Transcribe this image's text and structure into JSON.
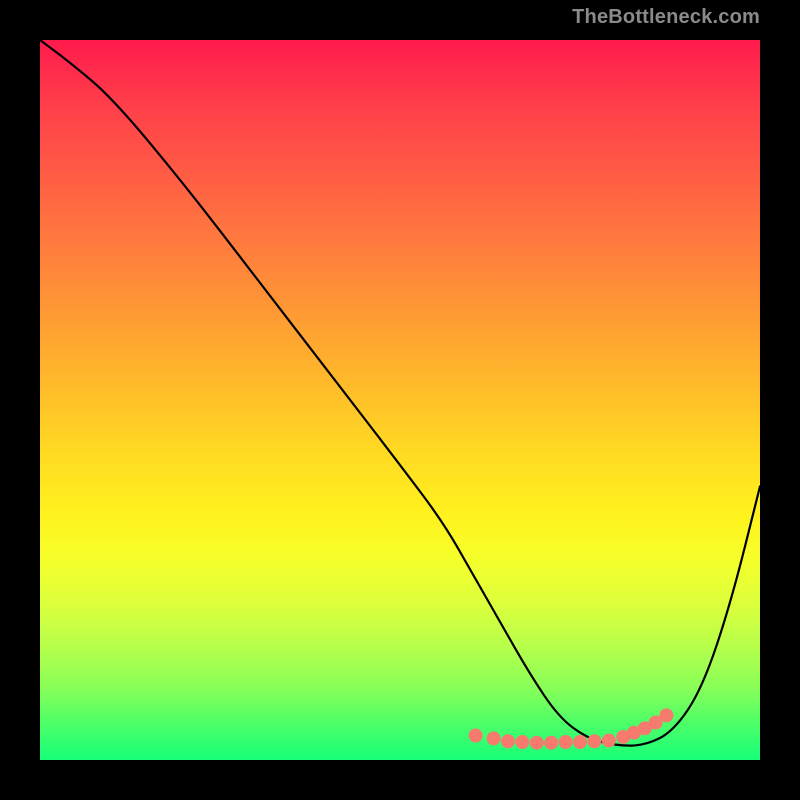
{
  "watermark": "TheBottleneck.com",
  "chart_data": {
    "type": "line",
    "title": "",
    "xlabel": "",
    "ylabel": "",
    "xlim": [
      0,
      100
    ],
    "ylim": [
      0,
      100
    ],
    "grid": false,
    "legend": false,
    "series": [
      {
        "name": "curve",
        "color": "#000000",
        "x": [
          0,
          4,
          10,
          20,
          30,
          40,
          50,
          56,
          60,
          64,
          68,
          72,
          76,
          80,
          84,
          88,
          92,
          96,
          100
        ],
        "y": [
          100,
          97,
          92,
          80,
          67,
          54,
          41,
          33,
          26,
          19,
          12,
          6,
          3,
          2,
          2,
          4,
          10,
          22,
          38
        ]
      },
      {
        "name": "highlight-dots",
        "color": "#f77a6f",
        "x": [
          60.5,
          63,
          65,
          67,
          69,
          71,
          73,
          75,
          77,
          79,
          81,
          82.5,
          84,
          85.5,
          87
        ],
        "y": [
          3.4,
          3.0,
          2.6,
          2.5,
          2.4,
          2.4,
          2.5,
          2.5,
          2.6,
          2.7,
          3.2,
          3.8,
          4.4,
          5.2,
          6.2
        ]
      }
    ],
    "annotations": []
  }
}
